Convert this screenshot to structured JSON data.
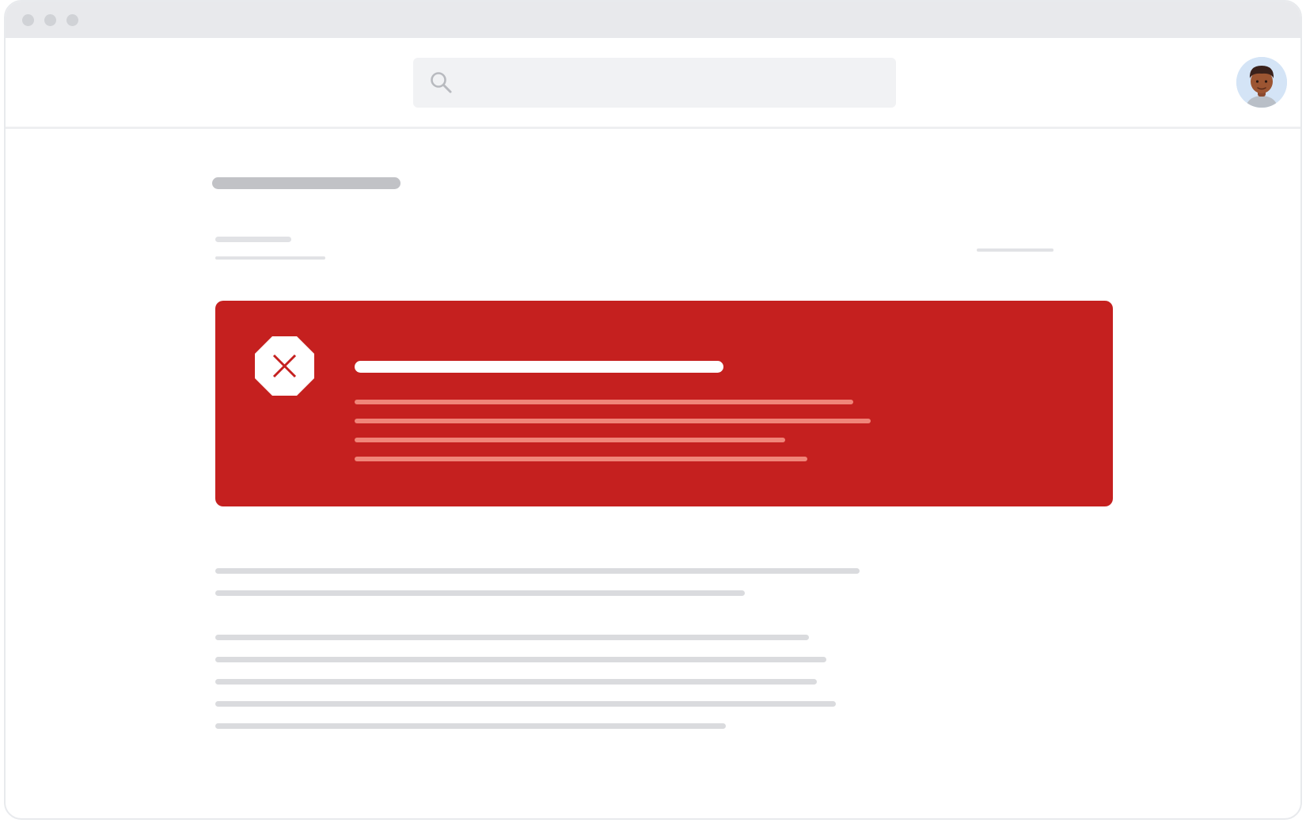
{
  "window": {
    "controls": [
      "close",
      "minimize",
      "maximize"
    ]
  },
  "header": {
    "search": {
      "placeholder": "",
      "icon": "search-icon"
    },
    "avatar": {
      "icon": "user-avatar"
    }
  },
  "page": {
    "title": "",
    "meta_left": "",
    "meta_sub": "",
    "meta_right": ""
  },
  "error_banner": {
    "icon": "error-stop-icon",
    "title": "",
    "body_lines": [
      "",
      "",
      "",
      ""
    ],
    "colors": {
      "background": "#c5201f",
      "icon_fill": "#ffffff",
      "icon_mark": "#c5201f",
      "title": "#ffffff",
      "body": "#f08579"
    }
  },
  "content": {
    "paragraph_1": [
      "",
      ""
    ],
    "paragraph_2": [
      "",
      "",
      "",
      "",
      ""
    ]
  },
  "colors": {
    "titlebar": "#e8e9ec",
    "search_bg": "#f1f2f4",
    "avatar_bg": "#d4e4f6",
    "placeholder_text": "#dadbde"
  }
}
